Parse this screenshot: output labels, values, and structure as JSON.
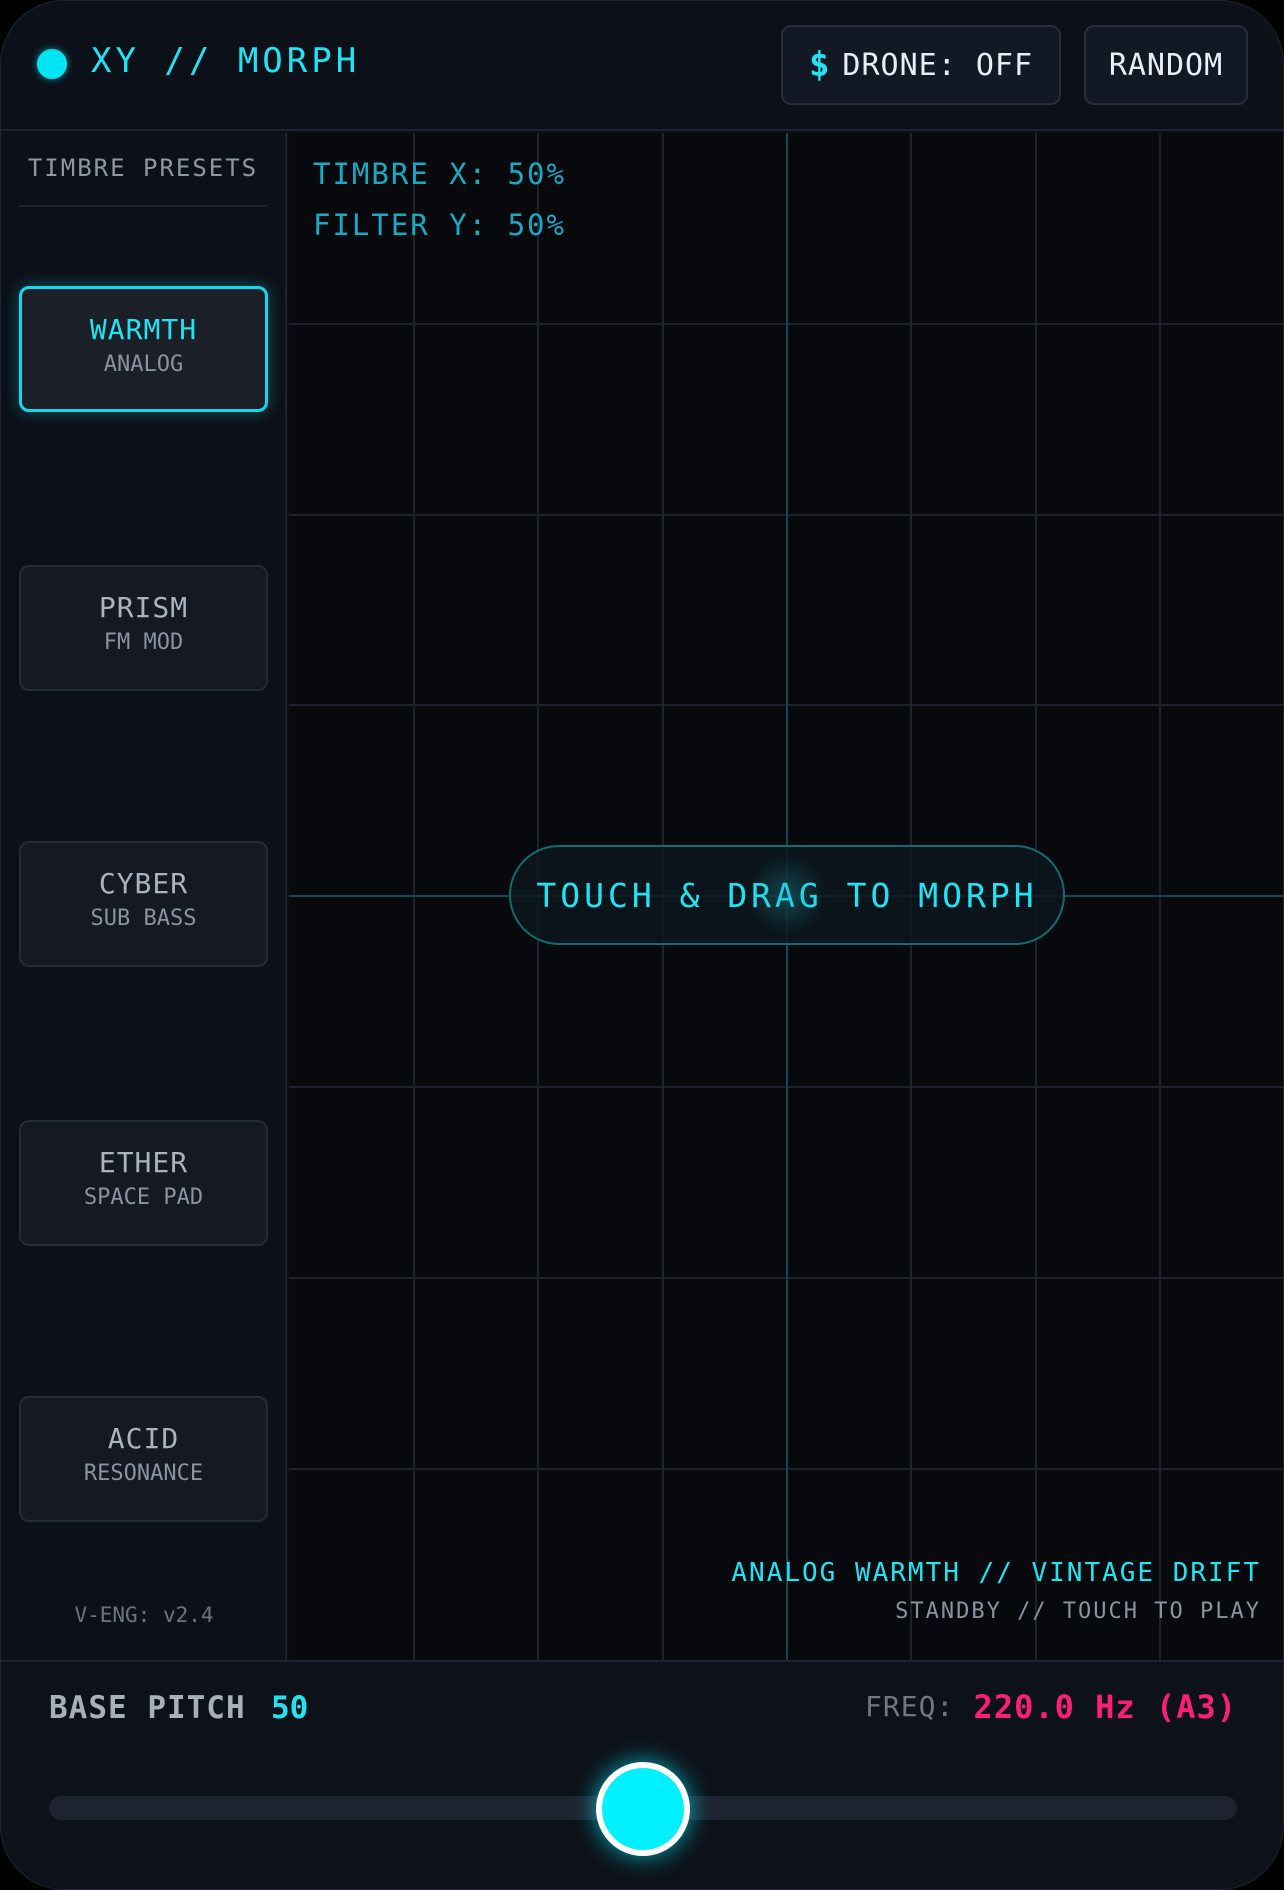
{
  "header": {
    "title": "XY // MORPH",
    "drone_icon": "$",
    "drone_label": "DRONE: OFF",
    "random_label": "RANDOM"
  },
  "sidebar": {
    "title": "TIMBRE PRESETS",
    "presets": [
      {
        "name": "WARMTH",
        "sub": "ANALOG",
        "active": true
      },
      {
        "name": "PRISM",
        "sub": "FM MOD",
        "active": false
      },
      {
        "name": "CYBER",
        "sub": "SUB BASS",
        "active": false
      },
      {
        "name": "ETHER",
        "sub": "SPACE PAD",
        "active": false
      },
      {
        "name": "ACID",
        "sub": "RESONANCE",
        "active": false
      }
    ],
    "version": "V-ENG: v2.4"
  },
  "pad": {
    "timbre_x": "TIMBRE X: 50%",
    "filter_y": "FILTER Y: 50%",
    "hint": "TOUCH & DRAG TO MORPH",
    "description": "ANALOG WARMTH // VINTAGE DRIFT",
    "status": "STANDBY // TOUCH TO PLAY"
  },
  "footer": {
    "pitch_label": "BASE PITCH",
    "pitch_value": "50",
    "pitch_fraction": 0.5,
    "freq_label": "FREQ:",
    "freq_value": "220.0 Hz (A3)"
  },
  "colors": {
    "accent": "#22e3f2",
    "freq": "#ff1f7a",
    "background": "#0b0e14"
  }
}
